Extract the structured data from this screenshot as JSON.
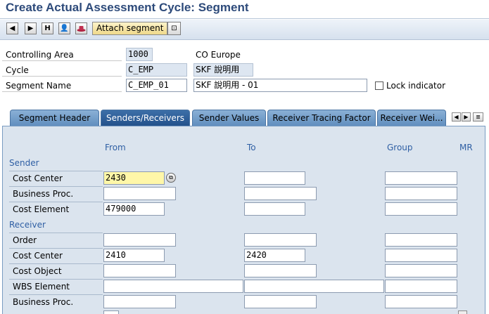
{
  "title": "Create Actual Assessment Cycle: Segment",
  "toolbar": {
    "prev_icon": "◀",
    "next_icon": "▶",
    "hierarchy_icon": "H",
    "person_icon": "👤",
    "attach_label": "Attach segment",
    "doc_icon": "⊡"
  },
  "header": {
    "controlling_area_label": "Controlling Area",
    "controlling_area_value": "1000",
    "controlling_area_text": "CO Europe",
    "cycle_label": "Cycle",
    "cycle_value": "C_EMP",
    "cycle_text": "SKF 說明用",
    "segment_name_label": "Segment Name",
    "segment_name_value": "C_EMP_01",
    "segment_desc": "SKF 說明用 - 01",
    "lock_label": "Lock indicator"
  },
  "tabs": [
    {
      "label": "Segment Header"
    },
    {
      "label": "Senders/Receivers"
    },
    {
      "label": "Sender Values"
    },
    {
      "label": "Receiver Tracing Factor"
    },
    {
      "label": "Receiver Wei..."
    }
  ],
  "columns": {
    "from": "From",
    "to": "To",
    "group": "Group",
    "mr": "MR"
  },
  "sender": {
    "section_label": "Sender",
    "rows": [
      {
        "label": "Cost Center",
        "from": "2430",
        "to": "",
        "group": ""
      },
      {
        "label": "Business Proc.",
        "from": "",
        "to": "",
        "group": ""
      },
      {
        "label": "Cost Element",
        "from": "479000",
        "to": "",
        "group": ""
      }
    ]
  },
  "receiver": {
    "section_label": "Receiver",
    "rows": [
      {
        "label": "Order",
        "from": "",
        "to": "",
        "group": ""
      },
      {
        "label": "Cost Center",
        "from": "2410",
        "to": "2420",
        "group": ""
      },
      {
        "label": "Cost Object",
        "from": "",
        "to": "",
        "group": ""
      },
      {
        "label": "WBS Element",
        "from": "",
        "to": "",
        "group": ""
      },
      {
        "label": "Business Proc.",
        "from": "",
        "to": "",
        "group": ""
      }
    ]
  },
  "colors": {
    "title": "#2d4a7a",
    "tab_active": "#22508a",
    "tab": "#5f8dbd",
    "panel": "#dbe4ee",
    "section": "#2f5fa4"
  }
}
